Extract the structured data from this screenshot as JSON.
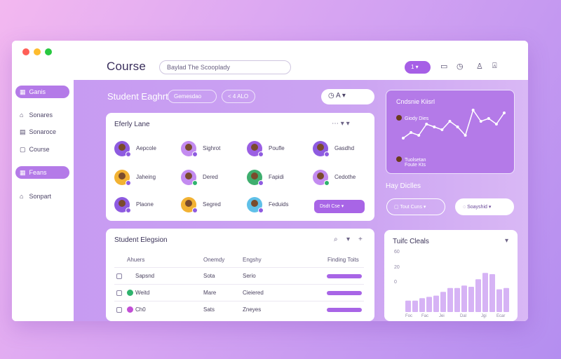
{
  "window": {
    "title": "Course",
    "search_placeholder": "Baylad The Scooplady",
    "top_pill": "1 ▾"
  },
  "colors": {
    "accent": "#a865e6",
    "panel": "#c79bf2",
    "close": "#ff5f57",
    "minimize": "#febc2e",
    "maximize": "#28c840"
  },
  "sidebar": {
    "items": [
      {
        "label": "Ganis",
        "icon": "grid-icon",
        "active": true
      },
      {
        "label": "Sonares",
        "icon": "home-icon"
      },
      {
        "label": "Sonaroce",
        "icon": "calendar-icon"
      },
      {
        "label": "Course",
        "icon": "book-icon"
      },
      {
        "label": "Feans",
        "icon": "group-icon",
        "active": true
      },
      {
        "label": "Sonpart",
        "icon": "home-icon"
      }
    ]
  },
  "subheader": {
    "title": "Student Eaghrt",
    "pill1": "Gemesdao",
    "pill2": "< 4 ALO",
    "tools": "◷   A  ▾"
  },
  "members_card": {
    "title": "Eferly Lane",
    "members": [
      {
        "name": "Aepcole",
        "avatar_color": "#8e5be0",
        "badge_color": "#8e5be0"
      },
      {
        "name": "Sighrot",
        "avatar_color": "#c38bf0",
        "badge_color": "#8e5be0"
      },
      {
        "name": "Poufle",
        "avatar_color": "#9b5fe3",
        "badge_color": "#8e5be0"
      },
      {
        "name": "Gasdhd",
        "avatar_color": "#8e5be0",
        "badge_color": "#8e5be0"
      },
      {
        "name": "Jaheing",
        "avatar_color": "#f2b233",
        "badge_color": "#8e5be0"
      },
      {
        "name": "Dered",
        "avatar_color": "#c38bf0",
        "badge_color": "#2fb36d"
      },
      {
        "name": "Fapidi",
        "avatar_color": "#3fae6e",
        "badge_color": "#8e5be0"
      },
      {
        "name": "Cedothe",
        "avatar_color": "#c38bf0",
        "badge_color": "#2fb36d"
      },
      {
        "name": "Plaone",
        "avatar_color": "#8e5be0",
        "badge_color": "#8e5be0"
      },
      {
        "name": "Segred",
        "avatar_color": "#f2b233",
        "badge_color": "#8e5be0"
      },
      {
        "name": "Feduids",
        "avatar_color": "#5fc0e8",
        "badge_color": "#8e5be0"
      }
    ],
    "button": "Dsdt Cse ▾"
  },
  "table_card": {
    "title": "Student Elegsion",
    "headers": [
      "Ahuers",
      "Onemdy",
      "Engshy",
      "Finding Toits"
    ],
    "rows": [
      {
        "name": "Sapsnd",
        "c2": "Sota",
        "c3": "Serio",
        "icon": "",
        "progress": 1.0
      },
      {
        "name": "Weitd",
        "c2": "Mare",
        "c3": "Cieiered",
        "icon": "#2fb36d",
        "progress": 1.0
      },
      {
        "name": "Ch0",
        "c2": "Sats",
        "c3": "Zneyes",
        "icon": "#c24fd6",
        "progress": 1.0
      }
    ]
  },
  "line_card": {
    "title": "Cndsnie Kiisrl",
    "legend": [
      "Giody Dies",
      "Tuolsetan"
    ],
    "legend2": "Foute Kts",
    "chart_data": {
      "type": "line",
      "points": [
        5,
        7,
        6,
        10,
        9,
        8,
        11,
        9,
        6,
        15,
        11,
        12,
        10,
        14
      ]
    }
  },
  "section": {
    "label": "Hay Diclles",
    "btn1": "▢  Tout Cuns ▾",
    "btn2": "◌  Soayshid ▾"
  },
  "bar_card": {
    "title": "Tuifc Cleals",
    "chart_data": {
      "type": "bar",
      "yticks": [
        "60",
        "20",
        "0"
      ],
      "xticks": [
        "Foc",
        "Fac",
        "Jei",
        "Dal",
        "Jgi",
        "Ecar"
      ],
      "values": [
        9,
        9,
        11,
        12,
        13,
        16,
        19,
        19,
        21,
        20,
        26,
        31,
        30,
        18,
        19
      ]
    }
  }
}
